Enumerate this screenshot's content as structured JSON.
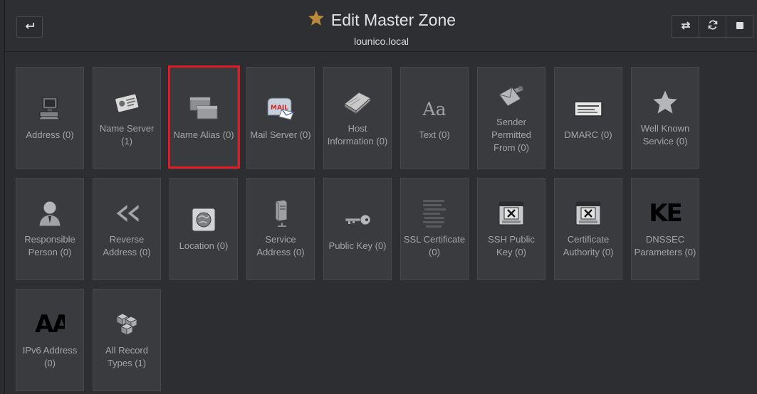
{
  "header": {
    "title": "Edit Master Zone",
    "subtitle": "lounico.local",
    "back_icon": "return-arrow-icon",
    "star_color": "#b98a3c"
  },
  "toolbar": {
    "buttons": [
      "swap-icon",
      "refresh-icon",
      "stop-icon"
    ]
  },
  "tiles": [
    {
      "label": "Address (0)",
      "icon": "computer-icon"
    },
    {
      "label": "Name Server (1)",
      "icon": "id-card-icon"
    },
    {
      "label": "Name Alias (0)",
      "icon": "windows-icon",
      "highlighted": true
    },
    {
      "label": "Mail Server (0)",
      "icon": "mailbox-icon"
    },
    {
      "label": "Host Information (0)",
      "icon": "book-icon"
    },
    {
      "label": "Text (0)",
      "icon": "text-icon",
      "glyph": "Aa"
    },
    {
      "label": "Sender Permitted From (0)",
      "icon": "envelope-tools-icon"
    },
    {
      "label": "DMARC (0)",
      "icon": "email-card-icon"
    },
    {
      "label": "Well Known Service (0)",
      "icon": "star-icon"
    },
    {
      "label": "Responsible Person (0)",
      "icon": "person-icon"
    },
    {
      "label": "Reverse Address (0)",
      "icon": "rewind-icon"
    },
    {
      "label": "Location (0)",
      "icon": "globe-icon"
    },
    {
      "label": "Service Address (0)",
      "icon": "server-icon"
    },
    {
      "label": "Public Key (0)",
      "icon": "key-icon"
    },
    {
      "label": "SSL Certificate (0)",
      "icon": "certificate-text-icon"
    },
    {
      "label": "SSH Public Key (0)",
      "icon": "not-found-icon"
    },
    {
      "label": "Certificate Authority (0)",
      "icon": "not-found-icon"
    },
    {
      "label": "DNSSEC Parameters (0)",
      "icon": "ke-text-icon",
      "glyph": "KE"
    },
    {
      "label": "IPv6 Address (0)",
      "icon": "aa-text-icon",
      "glyph": "AA"
    },
    {
      "label": "All Record Types (1)",
      "icon": "cubes-icon"
    }
  ]
}
